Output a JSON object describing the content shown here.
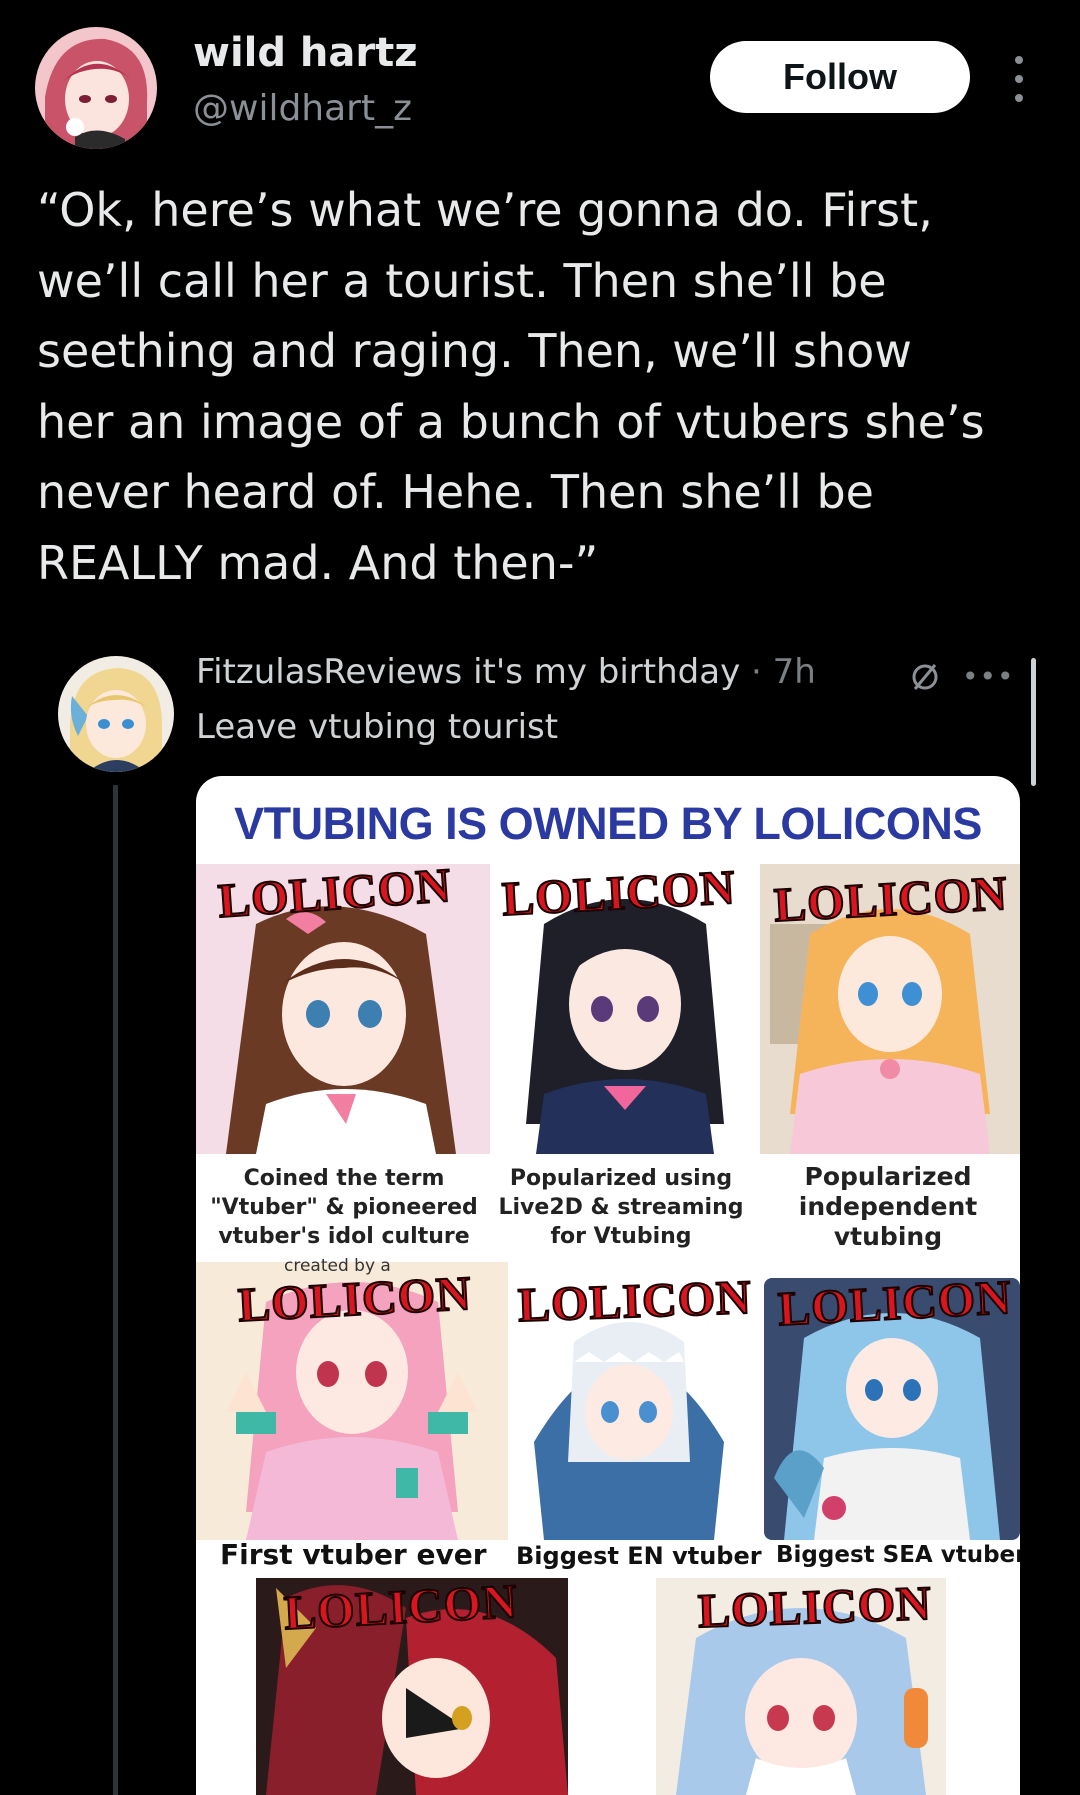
{
  "author": {
    "name": "wild hartz",
    "handle": "@wildhart_z",
    "follow_label": "Follow"
  },
  "tweet": {
    "lines": [
      "“Ok, here’s what we’re gonna do. First,",
      "we’ll call her a tourist. Then she’ll be",
      "seething and raging. Then, we’ll show",
      "her an image of a bunch of vtubers she’s",
      "never heard of. Hehe. Then she’ll be",
      "REALLY mad. And then-”"
    ]
  },
  "embedded": {
    "name": "FitzulasReviews it's my birthday",
    "meta": " · 7h",
    "reply_text": "Leave vtubing tourist",
    "icons": [
      "slash-circle-icon",
      "more-dots-icon"
    ]
  },
  "meme": {
    "title": "VTUBING IS OWNED BY LOLICONS",
    "stamp": "LOLICON",
    "captions": [
      [
        "Coined the term",
        "\"Vtuber\" & pioneered",
        "vtuber's idol culture"
      ],
      [
        "Popularized using",
        "Live2D & streaming",
        "for Vtubing"
      ],
      [
        "Popularized",
        "independent",
        "vtubing"
      ]
    ],
    "created_by": "created by a",
    "row2_captions": [
      "First vtuber ever",
      "Biggest EN vtuber",
      "Biggest SEA vtuber"
    ]
  },
  "colors": {
    "background": "#000000",
    "text": "#e7e9ea",
    "muted": "#8b9096",
    "follow_bg": "#ffffff",
    "meme_title": "#2a3aa0",
    "stamp_red": "#d7161f"
  }
}
